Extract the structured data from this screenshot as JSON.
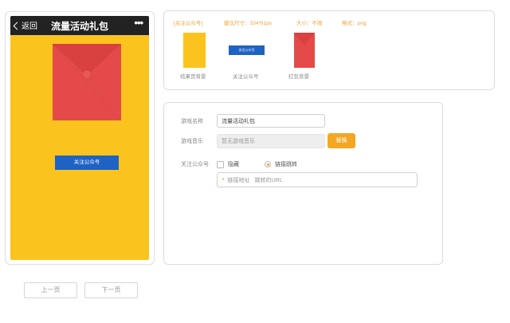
{
  "preview": {
    "back_label": "返回",
    "title": "流量活动礼包",
    "more": "•••",
    "follow_button": "关注公众号"
  },
  "assets": {
    "info": [
      {
        "label": "[关注公众号]"
      },
      {
        "label": "建议尺寸：334*81px"
      },
      {
        "label": "大小：不限"
      },
      {
        "label": "格式：png"
      }
    ],
    "thumb_button_text": "关注公众号",
    "captions": [
      "结果页背景",
      "关注公众号",
      "红包背景"
    ]
  },
  "form": {
    "game_name_label": "游戏名称",
    "game_name_value": "流量活动礼包",
    "music_label": "游戏音乐",
    "music_value": "暂无游戏音乐",
    "replace_button": "替换",
    "follow_label": "关注公众号",
    "hide_option": "隐藏",
    "link_option": "链接跳转",
    "url_field_label": "链接地址",
    "url_placeholder": "跳转的URL"
  },
  "pager": {
    "prev": "上一页",
    "next": "下一页"
  },
  "colors": {
    "phone_bg": "#fac31e",
    "envelope": "#e34a49",
    "primary_blue": "#1e63c4",
    "accent_orange": "#f5a623"
  }
}
